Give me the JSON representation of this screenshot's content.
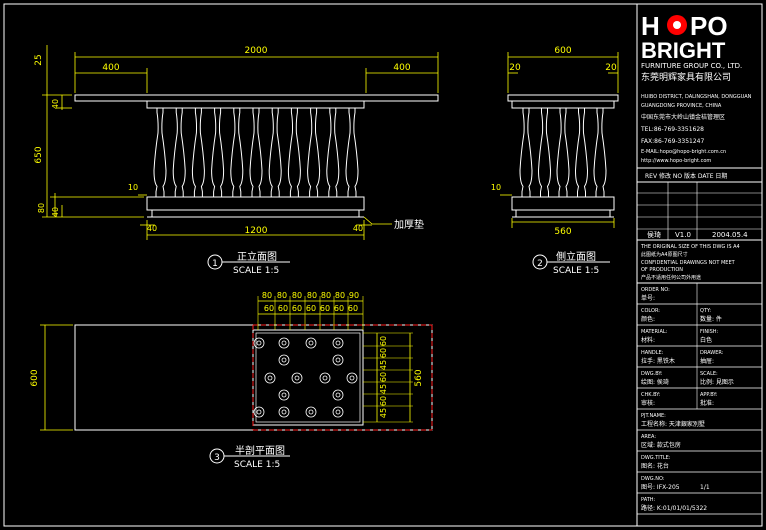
{
  "colors": {
    "background": "#000000",
    "outline": "#ffffff",
    "dimension": "#ffff00",
    "red": "#ff2020",
    "title_block_text": "#ffffff",
    "logo_dot": "#ff0000"
  },
  "logo": {
    "line1_left": "H",
    "line1_right": "PO",
    "line2": "BRIGHT",
    "group_line": "FURNITURE GROUP CO., LTD.",
    "cn_name": "东莞明辉家具有限公司"
  },
  "company_info": [
    "HUIBO DISTRICT, DALINGSHAN, DONGGUAN",
    "GUANGDONG PROVINCE, CHINA",
    "中国东莞市大岭山镇金桔管理区",
    "TEL:86-769-3351628",
    "FAX:86-769-3351247",
    "E-MAIL:hopo@hopo-bright.com.cn",
    "http://www.hopo-bright.com"
  ],
  "revision_header": "REV 修改   NO 版本   DATE 日期",
  "revisions": [
    {
      "a": "",
      "b": "",
      "c": "",
      "name": "",
      "date": ""
    },
    {
      "a": "",
      "b": "",
      "c": "",
      "name": "",
      "date": ""
    },
    {
      "a": "",
      "b": "",
      "c": "",
      "name": "",
      "date": ""
    },
    {
      "a": "",
      "b": "",
      "c": "",
      "name": "",
      "date": ""
    }
  ],
  "revision_row": {
    "name": "侯琦",
    "ver": "V1.0",
    "date": "2004.05.4"
  },
  "notes": [
    "THE ORIGINAL SIZE OF THIS DWG IS A4",
    "此图纸为A4原图尺寸",
    "CONFIDENTIAL DRAWINGS NOT MEET",
    "OF PRODUCTION",
    "产品不适用任何公司外用途"
  ],
  "title_fields": [
    {
      "en": "ORDER NO:",
      "cn": "单号:",
      "right_en": "",
      "right_cn": ""
    },
    {
      "en": "COLOR:",
      "cn": "颜色:",
      "right_en": "QTY:",
      "right_cn": "数量:",
      "right_val": "件"
    },
    {
      "en": "MATERIAL:",
      "cn": "材料:",
      "right_en": "FINISH:",
      "right_cn": "",
      "right_val": "白色"
    },
    {
      "en": "HANDLE:",
      "cn": "拉手:",
      "cn_val": "黑铁木",
      "right_en": "DRAWER:",
      "right_cn": "抽屉:"
    },
    {
      "en": "DWG.BY:",
      "cn": "绘图:",
      "cn_val": "侯琦",
      "right_en": "SCALE:",
      "right_cn": "比例:",
      "right_val": "見图示"
    },
    {
      "en": "CHK.BY:",
      "cn": "审核:",
      "right_en": "APP.BY:",
      "right_cn": "批准:"
    },
    {
      "en": "PJT.NAME:",
      "cn": "工程名称:",
      "cn_val": "天津銀家別墅"
    },
    {
      "en": "AREA:",
      "cn": "区域:",
      "cn_val": "款式包房"
    },
    {
      "en": "DWG.TITLE:",
      "cn": "图名:",
      "cn_val": "花台"
    },
    {
      "en": "DWG.NO:",
      "cn": "图号:",
      "cn_val": "IFX-205",
      "right_val": "1/1"
    },
    {
      "en": "PATH:",
      "cn": "路径:",
      "cn_val": "K:01/01/01/5322"
    }
  ],
  "view_labels": [
    {
      "num": "1",
      "title": "正立面图",
      "scale": "SCALE 1:5"
    },
    {
      "num": "2",
      "title": "側立面图",
      "scale": "SCALE 1:5"
    },
    {
      "num": "3",
      "title": "半剖平面图",
      "scale": "SCALE 1:5"
    }
  ],
  "dimensions": {
    "front_overall": "2000",
    "front_left_offset": "400",
    "front_right_offset": "400",
    "front_height": "650",
    "front_top_left": "25",
    "front_top_40": "40",
    "front_bottom_80": "80",
    "front_bottom_40": "40",
    "front_10": "10",
    "front_base": "1200",
    "front_base_left": "40",
    "front_base_right": "40",
    "front_callout": "加厚垫",
    "side_overall": "600",
    "side_left": "20",
    "side_right": "20",
    "side_10": "10",
    "side_base": "560",
    "plan_depth": "600",
    "plan_inner": "560",
    "plan_top_row": [
      "80",
      "80",
      "80",
      "80",
      "80",
      "80",
      "90"
    ],
    "plan_second_row": [
      "60",
      "60",
      "60",
      "60",
      "60",
      "60",
      "60"
    ],
    "plan_right_col": [
      "60",
      "60",
      "45",
      "60",
      "45",
      "60",
      "45"
    ]
  }
}
